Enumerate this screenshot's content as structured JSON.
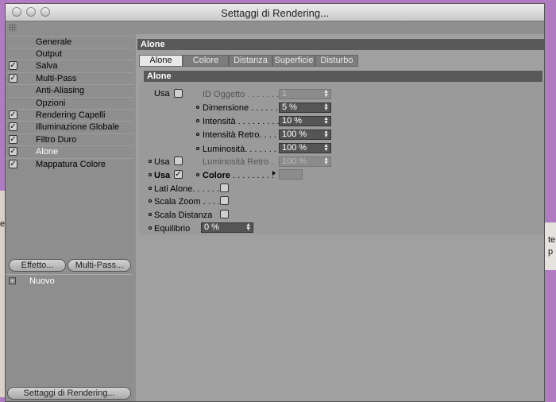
{
  "window": {
    "title": "Settaggi di Rendering..."
  },
  "desktop": {
    "left_text": "e",
    "right_text": [
      "te",
      "p"
    ]
  },
  "sidebar": {
    "items": [
      {
        "label": "Generale",
        "checked": false
      },
      {
        "label": "Output",
        "checked": false
      },
      {
        "label": "Salva",
        "checked": true
      },
      {
        "label": "Multi-Pass",
        "checked": true
      },
      {
        "label": "Anti-Aliasing",
        "checked": false
      },
      {
        "label": "Opzioni",
        "checked": false
      },
      {
        "label": "Rendering Capelli",
        "checked": true
      },
      {
        "label": "Illuminazione Globale",
        "checked": true
      },
      {
        "label": "Filtro Duro",
        "checked": true
      },
      {
        "label": "Alone",
        "checked": true,
        "selected": true
      },
      {
        "label": "Mappatura Colore",
        "checked": true
      }
    ],
    "effect_button": "Effetto...",
    "multipass_button": "Multi-Pass...",
    "preset_label": "Nuovo",
    "render_settings_button": "Settaggi di Rendering..."
  },
  "main": {
    "header": "Alone",
    "tabs": [
      "Alone",
      "Colore",
      "Distanza",
      "Superficie",
      "Disturbo"
    ],
    "section": "Alone",
    "usa1": "Usa",
    "id_oggetto": {
      "label": "ID Oggetto . . . . . . .",
      "value": "1"
    },
    "dimensione": {
      "label": "Dimensione . . . . . .",
      "value": "5 %"
    },
    "intensita": {
      "label": "Intensità . . . . . . . . .",
      "value": "10 %"
    },
    "intensita_retro": {
      "label": "Intensità Retro. . . . .",
      "value": "100 %"
    },
    "luminosita": {
      "label": "Luminosità. . . . . . .",
      "value": "100 %"
    },
    "usa2": "Usa",
    "luminosita_retro": {
      "label": "Luminosità Retro .",
      "value": "100 %"
    },
    "usa3": "Usa",
    "colore": {
      "label": "Colore",
      "dots": ". . . . . . . . ."
    },
    "lati_alone": "Lati Alone. . . . . .",
    "scala_zoom": "Scala Zoom . . . .",
    "scala_distanza": "Scala Distanza",
    "equilibrio": {
      "label": "Equilibrio",
      "value": "0 %"
    }
  },
  "colors": {
    "desktop": "#b07bc0",
    "panel": "#a0a0a0",
    "header": "#595959"
  }
}
